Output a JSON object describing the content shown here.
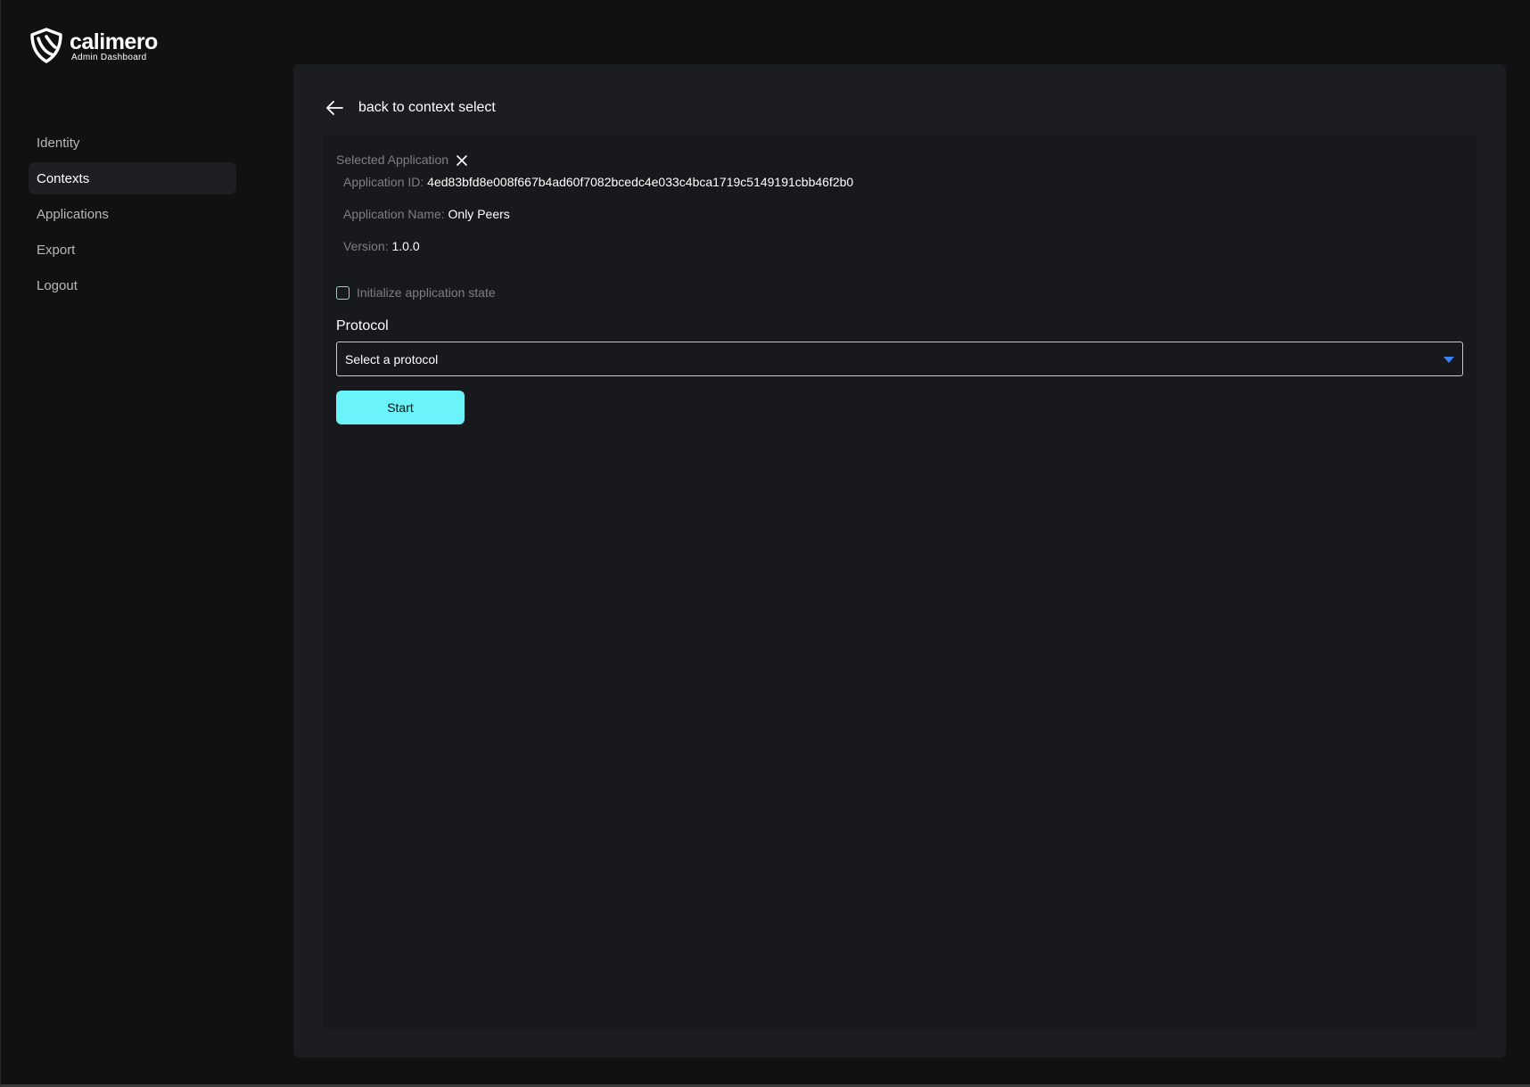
{
  "brand": {
    "name": "calimero",
    "subtitle": "Admin Dashboard",
    "icon": "calimero-shield-logo"
  },
  "sidebar": {
    "items": [
      {
        "label": "Identity",
        "active": false
      },
      {
        "label": "Contexts",
        "active": true
      },
      {
        "label": "Applications",
        "active": false
      },
      {
        "label": "Export",
        "active": false
      },
      {
        "label": "Logout",
        "active": false
      }
    ]
  },
  "main": {
    "back_label": "back to context select",
    "back_icon": "arrow-left-icon",
    "selected_application": {
      "header": "Selected Application",
      "close_icon": "close-icon",
      "id_key": "Application ID:",
      "id_value": "4ed83bfd8e008f667b4ad60f7082bcedc4e033c4bca1719c5149191cbb46f2b0",
      "name_key": "Application Name:",
      "name_value": "Only Peers",
      "version_key": "Version:",
      "version_value": "1.0.0"
    },
    "init_state": {
      "label": "Initialize application state",
      "checked": false
    },
    "protocol": {
      "label": "Protocol",
      "selected": "Select a protocol"
    },
    "start_label": "Start"
  },
  "colors": {
    "accent": "#6af3f8",
    "background": "#111111",
    "panel": "#1c1d20",
    "card": "#18191c",
    "muted_text": "#7d7f84",
    "dropdown_arrow": "#3b82f6"
  }
}
